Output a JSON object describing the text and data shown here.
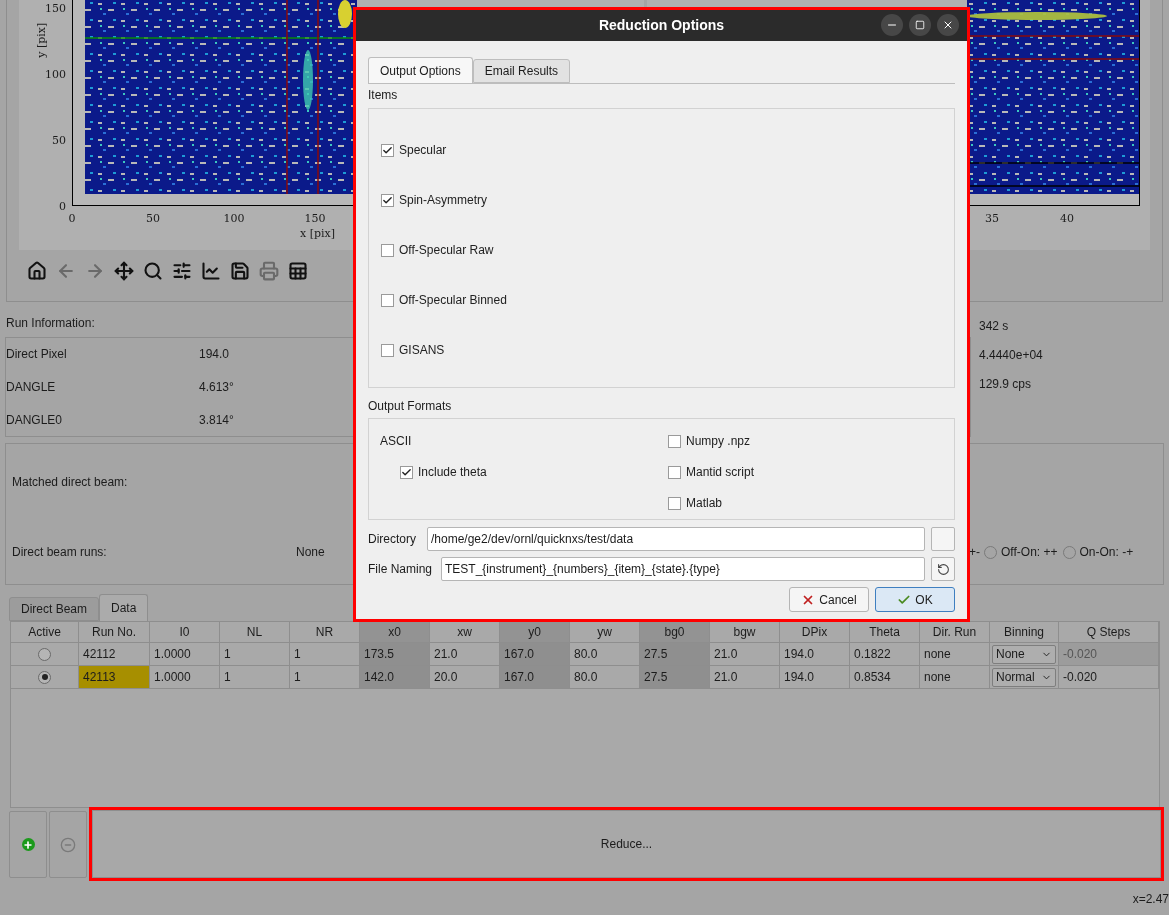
{
  "plots": [
    {
      "kind": "detector",
      "y_label": "y [pix]",
      "x_label": "x [pix]",
      "y_ticks": [
        "150",
        "100",
        "50",
        "0"
      ],
      "x_ticks": [
        "0",
        "50",
        "100",
        "150"
      ]
    },
    {
      "kind": "tof",
      "x_ticks": [
        "35",
        "40"
      ]
    }
  ],
  "toolbar": [
    {
      "disabled": false
    },
    {
      "disabled": true
    },
    {
      "disabled": true
    },
    {
      "disabled": false
    },
    {
      "disabled": false
    },
    {
      "disabled": false
    },
    {
      "disabled": false
    },
    {
      "disabled": false
    },
    {
      "disabled": true
    },
    {
      "disabled": false
    }
  ],
  "run_information": {
    "title": "Run Information:",
    "rows": [
      {
        "label": "Direct Pixel",
        "value": "194.0"
      },
      {
        "label": "DANGLE",
        "value": "4.613°"
      },
      {
        "label": "DANGLE0",
        "value": "3.814°"
      }
    ],
    "right_values": [
      "342 s",
      "4.4440e+04",
      "129.9 cps"
    ]
  },
  "direct_beam": {
    "matched_label": "Matched direct beam:",
    "runs_label": "Direct beam runs:",
    "runs_value": "None",
    "cut_label": "+-",
    "options": [
      {
        "label": "Off-On: ++",
        "selected": false
      },
      {
        "label": "On-On: -+",
        "selected": false
      }
    ]
  },
  "tabs": [
    {
      "label": "Direct Beam",
      "selected": false
    },
    {
      "label": "Data",
      "selected": true
    }
  ],
  "table": {
    "columns": [
      {
        "label": "Active",
        "shaded": false
      },
      {
        "label": "Run No.",
        "shaded": false
      },
      {
        "label": "I0",
        "shaded": false
      },
      {
        "label": "NL",
        "shaded": false
      },
      {
        "label": "NR",
        "shaded": false
      },
      {
        "label": "x0",
        "shaded": true
      },
      {
        "label": "xw",
        "shaded": false
      },
      {
        "label": "y0",
        "shaded": true
      },
      {
        "label": "yw",
        "shaded": false
      },
      {
        "label": "bg0",
        "shaded": true
      },
      {
        "label": "bgw",
        "shaded": false
      },
      {
        "label": "DPix",
        "shaded": false
      },
      {
        "label": "Theta",
        "shaded": false
      },
      {
        "label": "Dir. Run",
        "shaded": false
      },
      {
        "label": "Binning",
        "shaded": false
      },
      {
        "label": "Q Steps",
        "shaded": false
      }
    ],
    "rows": [
      {
        "selected": false,
        "run_no_highlighted": false,
        "q_steps_disabled": true,
        "cells": [
          "",
          "42112",
          "1.0000",
          "1",
          "1",
          "173.5",
          "21.0",
          "167.0",
          "80.0",
          "27.5",
          "21.0",
          "194.0",
          "0.1822",
          "none",
          "None",
          "-0.020"
        ]
      },
      {
        "selected": true,
        "run_no_highlighted": true,
        "q_steps_disabled": false,
        "cells": [
          "",
          "42113",
          "1.0000",
          "1",
          "1",
          "142.0",
          "20.0",
          "167.0",
          "80.0",
          "27.5",
          "21.0",
          "194.0",
          "0.8534",
          "none",
          "Normal",
          "-0.020"
        ]
      }
    ]
  },
  "reduce_button": "Reduce...",
  "status": "x=2.47",
  "dialog": {
    "title": "Reduction Options",
    "tabs": [
      {
        "label": "Output Options",
        "selected": true
      },
      {
        "label": "Email Results",
        "selected": false
      }
    ],
    "items_title": "Items",
    "items": [
      {
        "label": "Specular",
        "checked": true
      },
      {
        "label": "Spin-Asymmetry",
        "checked": true
      },
      {
        "label": "Off-Specular Raw",
        "checked": false
      },
      {
        "label": "Off-Specular Binned",
        "checked": false
      },
      {
        "label": "GISANS",
        "checked": false
      }
    ],
    "formats_title": "Output Formats",
    "ascii_label": "ASCII",
    "include_theta": {
      "label": "Include theta",
      "checked": true
    },
    "formats": [
      {
        "label": "Numpy .npz",
        "checked": false
      },
      {
        "label": "Mantid script",
        "checked": false
      },
      {
        "label": "Matlab",
        "checked": false
      }
    ],
    "directory": {
      "label": "Directory",
      "value": "/home/ge2/dev/ornl/quicknxs/test/data"
    },
    "file_naming": {
      "label": "File Naming",
      "value": "TEST_{instrument}_{numbers}_{item}_{state}.{type}"
    },
    "buttons": [
      {
        "label": "Cancel",
        "kind": "cancel"
      },
      {
        "label": "OK",
        "kind": "ok"
      }
    ]
  }
}
